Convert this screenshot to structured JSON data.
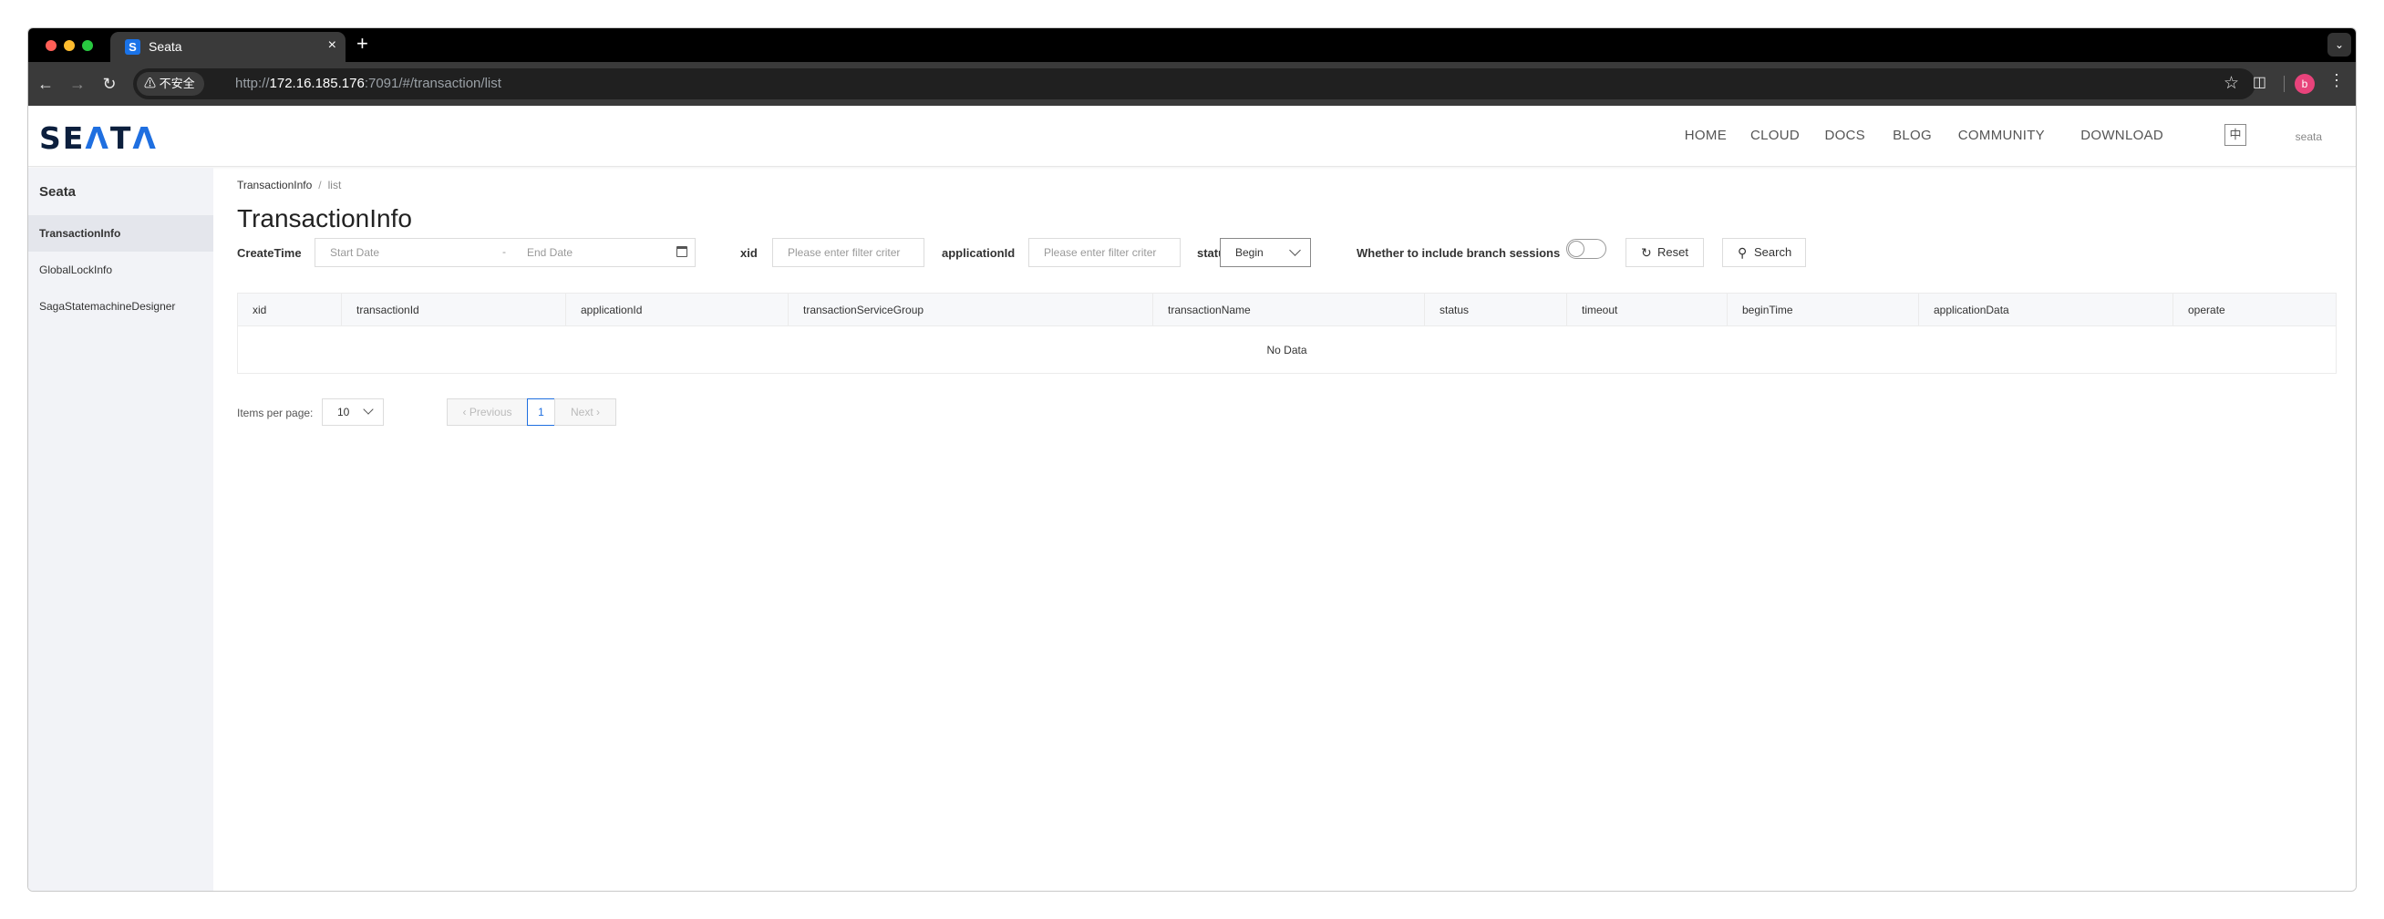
{
  "browser": {
    "tab_title": "Seata",
    "tab_favicon": "S",
    "tab_close": "×",
    "new_tab": "+",
    "security_label": "不安全",
    "url_scheme": "http://",
    "url_host": "172.16.185.176",
    "url_rest": ":7091/#/transaction/list",
    "profile_initial": "b"
  },
  "header": {
    "logo_pre": "SE",
    "logo_a": "Λ",
    "logo_t": "T",
    "logo_a2": "Λ",
    "nav": [
      "HOME",
      "CLOUD",
      "DOCS",
      "BLOG",
      "COMMUNITY",
      "DOWNLOAD"
    ],
    "lang_toggle": "中",
    "user": "seata"
  },
  "sidebar": {
    "title": "Seata",
    "items": [
      {
        "label": "TransactionInfo",
        "active": true
      },
      {
        "label": "GlobalLockInfo",
        "active": false
      },
      {
        "label": "SagaStatemachineDesigner",
        "active": false
      }
    ]
  },
  "breadcrumb": {
    "root": "TransactionInfo",
    "separator": "/",
    "current": "list"
  },
  "page_title": "TransactionInfo",
  "filters": {
    "create_time_label": "CreateTime",
    "start_date": "Start Date",
    "range_dash": "-",
    "end_date": "End Date",
    "xid_label": "xid",
    "xid_placeholder": "Please enter filter criter",
    "application_id_label": "applicationId",
    "application_id_placeholder": "Please enter filter criter",
    "status_label": "status",
    "status_value": "Begin",
    "branch_label": "Whether to include branch sessions",
    "branch_on": false,
    "reset_label": "Reset",
    "search_label": "Search"
  },
  "table": {
    "columns": [
      "xid",
      "transactionId",
      "applicationId",
      "transactionServiceGroup",
      "transactionName",
      "status",
      "timeout",
      "beginTime",
      "applicationData",
      "operate"
    ],
    "empty_text": "No Data"
  },
  "pagination": {
    "items_per_page_label": "Items per page:",
    "page_size": "10",
    "prev_label": "Previous",
    "next_label": "Next",
    "current_page": "1"
  },
  "colors": {
    "accent": "#1f6fe0",
    "sidebar_bg": "#f2f3f7",
    "browser_chrome": "#3a3a3a"
  }
}
